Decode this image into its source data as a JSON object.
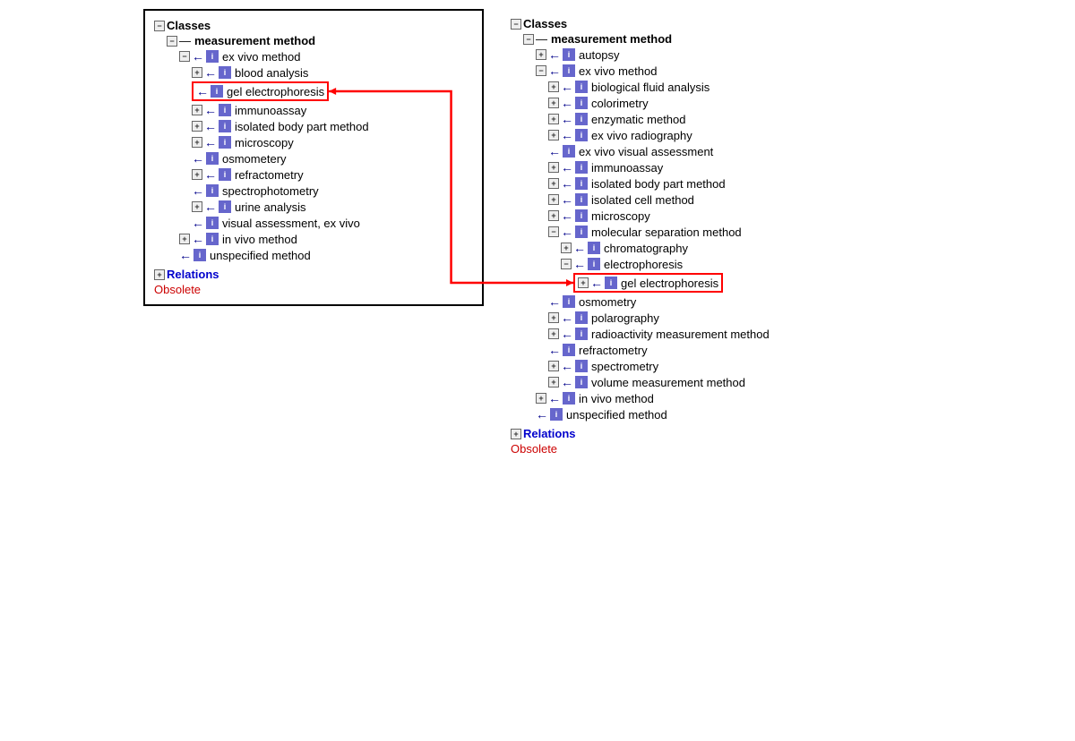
{
  "left_panel": {
    "sections": [
      {
        "type": "header",
        "label": "Classes",
        "icon": "minus"
      },
      {
        "type": "node",
        "indent": 1,
        "dash": true,
        "label": "measurement method",
        "bold": true
      },
      {
        "type": "node",
        "indent": 2,
        "expand": "minus",
        "arrow": true,
        "info": true,
        "label": "ex vivo method"
      },
      {
        "type": "node",
        "indent": 3,
        "expand": "plus",
        "arrow": true,
        "info": true,
        "label": "blood analysis"
      },
      {
        "type": "node",
        "indent": 3,
        "arrow": true,
        "info": true,
        "label": "gel electrophoresis",
        "highlight": true
      },
      {
        "type": "node",
        "indent": 3,
        "expand": "plus",
        "arrow": true,
        "info": true,
        "label": "immunoassay"
      },
      {
        "type": "node",
        "indent": 3,
        "expand": "plus",
        "arrow": true,
        "info": true,
        "label": "isolated body part method"
      },
      {
        "type": "node",
        "indent": 3,
        "expand": "plus",
        "arrow": true,
        "info": true,
        "label": "microscopy"
      },
      {
        "type": "node",
        "indent": 3,
        "arrow": true,
        "info": true,
        "label": "osmometery"
      },
      {
        "type": "node",
        "indent": 3,
        "expand": "plus",
        "arrow": true,
        "info": true,
        "label": "refractometry"
      },
      {
        "type": "node",
        "indent": 3,
        "arrow": true,
        "info": true,
        "label": "spectrophotometry"
      },
      {
        "type": "node",
        "indent": 3,
        "expand": "plus",
        "arrow": true,
        "info": true,
        "label": "urine analysis"
      },
      {
        "type": "node",
        "indent": 3,
        "arrow": true,
        "info": true,
        "label": "visual assessment, ex vivo"
      },
      {
        "type": "node",
        "indent": 2,
        "expand": "plus",
        "arrow": true,
        "info": true,
        "label": "in vivo method"
      },
      {
        "type": "node",
        "indent": 2,
        "arrow": true,
        "info": true,
        "label": "unspecified method"
      }
    ],
    "relations": {
      "label": "Relations",
      "obsolete": "Obsolete"
    }
  },
  "right_panel": {
    "sections": [
      {
        "type": "header",
        "label": "Classes",
        "icon": "minus"
      },
      {
        "type": "node",
        "indent": 1,
        "dash": true,
        "label": "measurement method",
        "bold": true
      },
      {
        "type": "node",
        "indent": 2,
        "expand": "plus",
        "arrow": true,
        "info": true,
        "label": "autopsy"
      },
      {
        "type": "node",
        "indent": 2,
        "expand": "minus",
        "arrow": true,
        "info": true,
        "label": "ex vivo method"
      },
      {
        "type": "node",
        "indent": 3,
        "expand": "plus",
        "arrow": true,
        "info": true,
        "label": "biological fluid analysis"
      },
      {
        "type": "node",
        "indent": 3,
        "expand": "plus",
        "arrow": true,
        "info": true,
        "label": "colorimetry"
      },
      {
        "type": "node",
        "indent": 3,
        "expand": "plus",
        "arrow": true,
        "info": true,
        "label": "enzymatic method"
      },
      {
        "type": "node",
        "indent": 3,
        "expand": "plus",
        "arrow": true,
        "info": true,
        "label": "ex vivo radiography"
      },
      {
        "type": "node",
        "indent": 3,
        "arrow": true,
        "info": true,
        "label": "ex vivo visual assessment"
      },
      {
        "type": "node",
        "indent": 3,
        "expand": "plus",
        "arrow": true,
        "info": true,
        "label": "immunoassay"
      },
      {
        "type": "node",
        "indent": 3,
        "expand": "plus",
        "arrow": true,
        "info": true,
        "label": "isolated body part method"
      },
      {
        "type": "node",
        "indent": 3,
        "expand": "plus",
        "arrow": true,
        "info": true,
        "label": "isolated cell method"
      },
      {
        "type": "node",
        "indent": 3,
        "expand": "plus",
        "arrow": true,
        "info": true,
        "label": "microscopy"
      },
      {
        "type": "node",
        "indent": 3,
        "expand": "minus",
        "arrow": true,
        "info": true,
        "label": "molecular separation method"
      },
      {
        "type": "node",
        "indent": 4,
        "expand": "plus",
        "arrow": true,
        "info": true,
        "label": "chromatography"
      },
      {
        "type": "node",
        "indent": 4,
        "expand": "minus",
        "arrow": true,
        "info": true,
        "label": "electrophoresis"
      },
      {
        "type": "node",
        "indent": 5,
        "expand": "plus",
        "arrow": true,
        "info": true,
        "label": "gel electrophoresis",
        "highlight": true
      },
      {
        "type": "node",
        "indent": 3,
        "arrow": true,
        "info": true,
        "label": "osmometry"
      },
      {
        "type": "node",
        "indent": 3,
        "expand": "plus",
        "arrow": true,
        "info": true,
        "label": "polarography"
      },
      {
        "type": "node",
        "indent": 3,
        "expand": "plus",
        "arrow": true,
        "info": true,
        "label": "radioactivity measurement method"
      },
      {
        "type": "node",
        "indent": 3,
        "arrow": true,
        "info": true,
        "label": "refractometry"
      },
      {
        "type": "node",
        "indent": 3,
        "expand": "plus",
        "arrow": true,
        "info": true,
        "label": "spectrometry"
      },
      {
        "type": "node",
        "indent": 3,
        "expand": "plus",
        "arrow": true,
        "info": true,
        "label": "volume measurement method"
      },
      {
        "type": "node",
        "indent": 2,
        "expand": "plus",
        "arrow": true,
        "info": true,
        "label": "in vivo method"
      },
      {
        "type": "node",
        "indent": 2,
        "arrow": true,
        "info": true,
        "label": "unspecified method"
      }
    ],
    "relations": {
      "label": "Relations",
      "obsolete": "Obsolete"
    }
  }
}
